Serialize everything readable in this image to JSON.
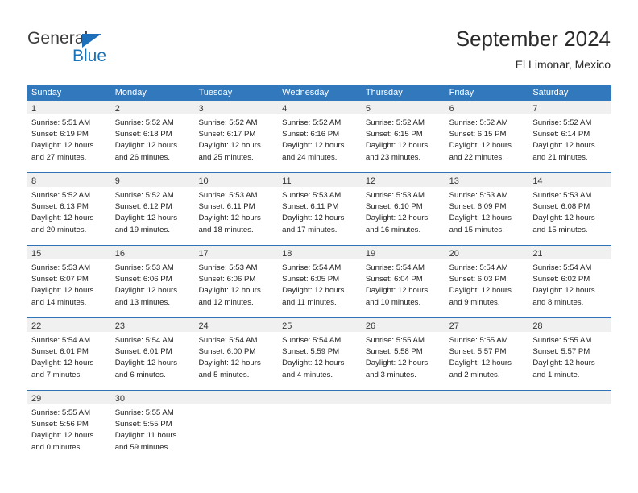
{
  "brand": {
    "name_part1": "General",
    "name_part2": "Blue",
    "accent_color": "#1a73b8",
    "triangle_color": "#1e6fba"
  },
  "header": {
    "title": "September 2024",
    "subtitle": "El Limonar, Mexico"
  },
  "theme": {
    "header_row_bg": "#3178bd",
    "header_row_text": "#ffffff",
    "row_divider": "#2f72b5",
    "day_number_band_bg": "#f0f0f0",
    "cell_bg": "#ffffff",
    "text_color": "#222222"
  },
  "calendar": {
    "weekday_headers": [
      "Sunday",
      "Monday",
      "Tuesday",
      "Wednesday",
      "Thursday",
      "Friday",
      "Saturday"
    ],
    "weeks": [
      [
        {
          "day": "1",
          "sunrise": "Sunrise: 5:51 AM",
          "sunset": "Sunset: 6:19 PM",
          "daylight1": "Daylight: 12 hours",
          "daylight2": "and 27 minutes."
        },
        {
          "day": "2",
          "sunrise": "Sunrise: 5:52 AM",
          "sunset": "Sunset: 6:18 PM",
          "daylight1": "Daylight: 12 hours",
          "daylight2": "and 26 minutes."
        },
        {
          "day": "3",
          "sunrise": "Sunrise: 5:52 AM",
          "sunset": "Sunset: 6:17 PM",
          "daylight1": "Daylight: 12 hours",
          "daylight2": "and 25 minutes."
        },
        {
          "day": "4",
          "sunrise": "Sunrise: 5:52 AM",
          "sunset": "Sunset: 6:16 PM",
          "daylight1": "Daylight: 12 hours",
          "daylight2": "and 24 minutes."
        },
        {
          "day": "5",
          "sunrise": "Sunrise: 5:52 AM",
          "sunset": "Sunset: 6:15 PM",
          "daylight1": "Daylight: 12 hours",
          "daylight2": "and 23 minutes."
        },
        {
          "day": "6",
          "sunrise": "Sunrise: 5:52 AM",
          "sunset": "Sunset: 6:15 PM",
          "daylight1": "Daylight: 12 hours",
          "daylight2": "and 22 minutes."
        },
        {
          "day": "7",
          "sunrise": "Sunrise: 5:52 AM",
          "sunset": "Sunset: 6:14 PM",
          "daylight1": "Daylight: 12 hours",
          "daylight2": "and 21 minutes."
        }
      ],
      [
        {
          "day": "8",
          "sunrise": "Sunrise: 5:52 AM",
          "sunset": "Sunset: 6:13 PM",
          "daylight1": "Daylight: 12 hours",
          "daylight2": "and 20 minutes."
        },
        {
          "day": "9",
          "sunrise": "Sunrise: 5:52 AM",
          "sunset": "Sunset: 6:12 PM",
          "daylight1": "Daylight: 12 hours",
          "daylight2": "and 19 minutes."
        },
        {
          "day": "10",
          "sunrise": "Sunrise: 5:53 AM",
          "sunset": "Sunset: 6:11 PM",
          "daylight1": "Daylight: 12 hours",
          "daylight2": "and 18 minutes."
        },
        {
          "day": "11",
          "sunrise": "Sunrise: 5:53 AM",
          "sunset": "Sunset: 6:11 PM",
          "daylight1": "Daylight: 12 hours",
          "daylight2": "and 17 minutes."
        },
        {
          "day": "12",
          "sunrise": "Sunrise: 5:53 AM",
          "sunset": "Sunset: 6:10 PM",
          "daylight1": "Daylight: 12 hours",
          "daylight2": "and 16 minutes."
        },
        {
          "day": "13",
          "sunrise": "Sunrise: 5:53 AM",
          "sunset": "Sunset: 6:09 PM",
          "daylight1": "Daylight: 12 hours",
          "daylight2": "and 15 minutes."
        },
        {
          "day": "14",
          "sunrise": "Sunrise: 5:53 AM",
          "sunset": "Sunset: 6:08 PM",
          "daylight1": "Daylight: 12 hours",
          "daylight2": "and 15 minutes."
        }
      ],
      [
        {
          "day": "15",
          "sunrise": "Sunrise: 5:53 AM",
          "sunset": "Sunset: 6:07 PM",
          "daylight1": "Daylight: 12 hours",
          "daylight2": "and 14 minutes."
        },
        {
          "day": "16",
          "sunrise": "Sunrise: 5:53 AM",
          "sunset": "Sunset: 6:06 PM",
          "daylight1": "Daylight: 12 hours",
          "daylight2": "and 13 minutes."
        },
        {
          "day": "17",
          "sunrise": "Sunrise: 5:53 AM",
          "sunset": "Sunset: 6:06 PM",
          "daylight1": "Daylight: 12 hours",
          "daylight2": "and 12 minutes."
        },
        {
          "day": "18",
          "sunrise": "Sunrise: 5:54 AM",
          "sunset": "Sunset: 6:05 PM",
          "daylight1": "Daylight: 12 hours",
          "daylight2": "and 11 minutes."
        },
        {
          "day": "19",
          "sunrise": "Sunrise: 5:54 AM",
          "sunset": "Sunset: 6:04 PM",
          "daylight1": "Daylight: 12 hours",
          "daylight2": "and 10 minutes."
        },
        {
          "day": "20",
          "sunrise": "Sunrise: 5:54 AM",
          "sunset": "Sunset: 6:03 PM",
          "daylight1": "Daylight: 12 hours",
          "daylight2": "and 9 minutes."
        },
        {
          "day": "21",
          "sunrise": "Sunrise: 5:54 AM",
          "sunset": "Sunset: 6:02 PM",
          "daylight1": "Daylight: 12 hours",
          "daylight2": "and 8 minutes."
        }
      ],
      [
        {
          "day": "22",
          "sunrise": "Sunrise: 5:54 AM",
          "sunset": "Sunset: 6:01 PM",
          "daylight1": "Daylight: 12 hours",
          "daylight2": "and 7 minutes."
        },
        {
          "day": "23",
          "sunrise": "Sunrise: 5:54 AM",
          "sunset": "Sunset: 6:01 PM",
          "daylight1": "Daylight: 12 hours",
          "daylight2": "and 6 minutes."
        },
        {
          "day": "24",
          "sunrise": "Sunrise: 5:54 AM",
          "sunset": "Sunset: 6:00 PM",
          "daylight1": "Daylight: 12 hours",
          "daylight2": "and 5 minutes."
        },
        {
          "day": "25",
          "sunrise": "Sunrise: 5:54 AM",
          "sunset": "Sunset: 5:59 PM",
          "daylight1": "Daylight: 12 hours",
          "daylight2": "and 4 minutes."
        },
        {
          "day": "26",
          "sunrise": "Sunrise: 5:55 AM",
          "sunset": "Sunset: 5:58 PM",
          "daylight1": "Daylight: 12 hours",
          "daylight2": "and 3 minutes."
        },
        {
          "day": "27",
          "sunrise": "Sunrise: 5:55 AM",
          "sunset": "Sunset: 5:57 PM",
          "daylight1": "Daylight: 12 hours",
          "daylight2": "and 2 minutes."
        },
        {
          "day": "28",
          "sunrise": "Sunrise: 5:55 AM",
          "sunset": "Sunset: 5:57 PM",
          "daylight1": "Daylight: 12 hours",
          "daylight2": "and 1 minute."
        }
      ],
      [
        {
          "day": "29",
          "sunrise": "Sunrise: 5:55 AM",
          "sunset": "Sunset: 5:56 PM",
          "daylight1": "Daylight: 12 hours",
          "daylight2": "and 0 minutes."
        },
        {
          "day": "30",
          "sunrise": "Sunrise: 5:55 AM",
          "sunset": "Sunset: 5:55 PM",
          "daylight1": "Daylight: 11 hours",
          "daylight2": "and 59 minutes."
        },
        {
          "day": "",
          "sunrise": "",
          "sunset": "",
          "daylight1": "",
          "daylight2": ""
        },
        {
          "day": "",
          "sunrise": "",
          "sunset": "",
          "daylight1": "",
          "daylight2": ""
        },
        {
          "day": "",
          "sunrise": "",
          "sunset": "",
          "daylight1": "",
          "daylight2": ""
        },
        {
          "day": "",
          "sunrise": "",
          "sunset": "",
          "daylight1": "",
          "daylight2": ""
        },
        {
          "day": "",
          "sunrise": "",
          "sunset": "",
          "daylight1": "",
          "daylight2": ""
        }
      ]
    ]
  }
}
